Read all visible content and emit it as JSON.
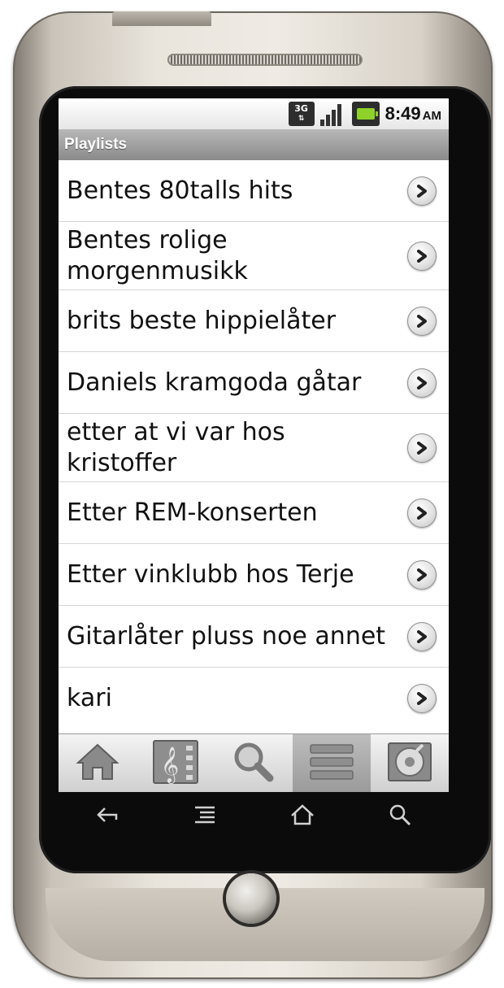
{
  "device": {
    "hardware_keys": [
      {
        "name": "back-icon"
      },
      {
        "name": "menu-icon"
      },
      {
        "name": "home-icon"
      },
      {
        "name": "search-icon"
      }
    ]
  },
  "status_bar": {
    "network": "3G",
    "time": "8:49",
    "ampm": "AM",
    "battery_color": "#8ed12b"
  },
  "header": {
    "title": "Playlists"
  },
  "playlists": [
    {
      "line1": "Bentes 80talls hits",
      "line2": ""
    },
    {
      "line1": "Bentes rolige",
      "line2": "morgenmusikk"
    },
    {
      "line1": "brits beste hippielåter",
      "line2": ""
    },
    {
      "line1": "Daniels kramgoda gåtar",
      "line2": ""
    },
    {
      "line1": "etter at vi var hos",
      "line2": "kristoffer"
    },
    {
      "line1": "Etter REM-konserten",
      "line2": ""
    },
    {
      "line1": "Etter vinklubb hos Terje",
      "line2": ""
    },
    {
      "line1": "Gitarlåter pluss noe annet",
      "line2": ""
    },
    {
      "line1": "kari",
      "line2": ""
    }
  ],
  "tabs": [
    {
      "icon": "home-icon",
      "selected": false
    },
    {
      "icon": "music-library-icon",
      "selected": false
    },
    {
      "icon": "search-icon",
      "selected": false
    },
    {
      "icon": "playlists-icon",
      "selected": true
    },
    {
      "icon": "now-playing-icon",
      "selected": false
    }
  ]
}
